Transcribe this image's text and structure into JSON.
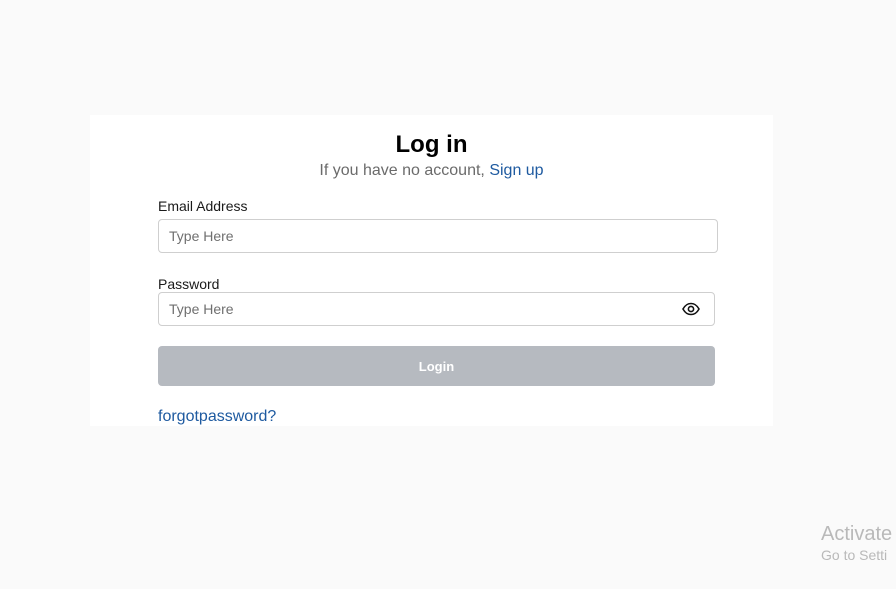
{
  "login": {
    "title": "Log in",
    "subtitle_text": "If you have no account, ",
    "signup_link": "Sign up",
    "email_label": "Email Address",
    "email_placeholder": "Type Here",
    "email_value": "",
    "password_label": "Password",
    "password_placeholder": "Type Here",
    "password_value": "",
    "password_toggle_icon": "eye-icon",
    "login_button": "Login",
    "forgot_link": "forgotpassword?"
  },
  "watermark": {
    "line1": "Activate",
    "line2": "Go to Setti"
  },
  "colors": {
    "background": "#fafafa",
    "card": "#ffffff",
    "link": "#1e5aa0",
    "button_disabled": "#b6bac0"
  }
}
